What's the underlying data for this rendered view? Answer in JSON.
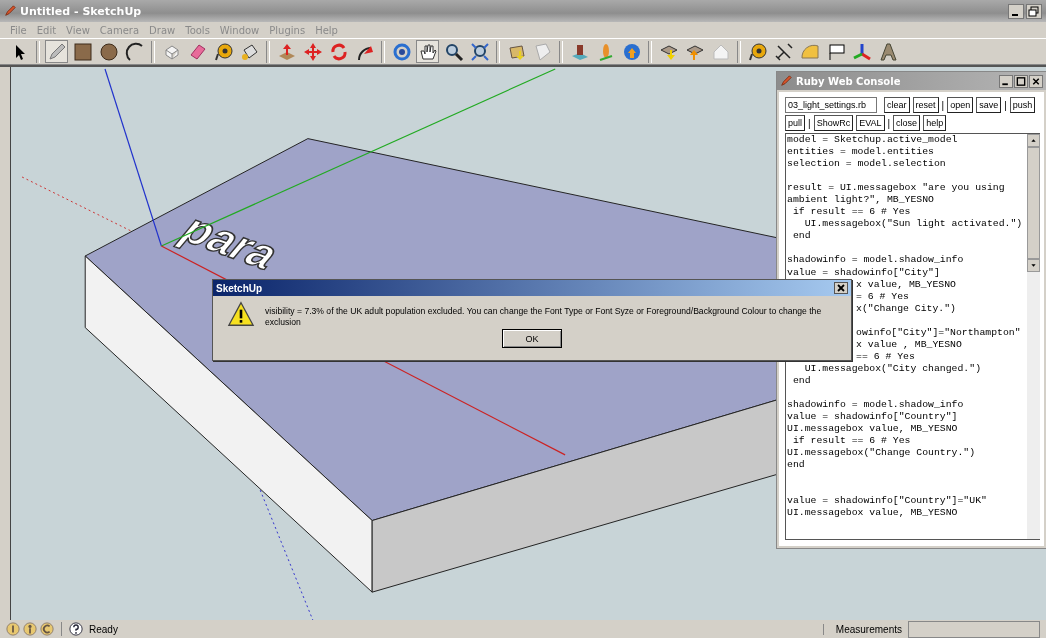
{
  "window": {
    "title": "Untitled - SketchUp"
  },
  "menu": [
    "File",
    "Edit",
    "View",
    "Camera",
    "Draw",
    "Tools",
    "Window",
    "Plugins",
    "Help"
  ],
  "toolbar": [
    {
      "kind": "select",
      "selected": false
    },
    {
      "kind": "sep"
    },
    {
      "kind": "pencil",
      "selected": true
    },
    {
      "kind": "rect",
      "selected": false
    },
    {
      "kind": "circle",
      "selected": false
    },
    {
      "kind": "arc",
      "selected": false
    },
    {
      "kind": "sep"
    },
    {
      "kind": "cube",
      "selected": false
    },
    {
      "kind": "eraser",
      "selected": false
    },
    {
      "kind": "tape",
      "selected": false
    },
    {
      "kind": "bucket",
      "selected": false
    },
    {
      "kind": "sep"
    },
    {
      "kind": "pushpull",
      "selected": false
    },
    {
      "kind": "move",
      "selected": false
    },
    {
      "kind": "rotate",
      "selected": false
    },
    {
      "kind": "offset",
      "selected": false
    },
    {
      "kind": "sep"
    },
    {
      "kind": "orbit",
      "selected": false
    },
    {
      "kind": "pan",
      "selected": true
    },
    {
      "kind": "zoom",
      "selected": false
    },
    {
      "kind": "extents",
      "selected": false
    },
    {
      "kind": "sep"
    },
    {
      "kind": "box",
      "selected": false
    },
    {
      "kind": "page",
      "selected": false
    },
    {
      "kind": "sep"
    },
    {
      "kind": "terrain",
      "selected": false
    },
    {
      "kind": "figure",
      "selected": false
    },
    {
      "kind": "globe",
      "selected": false
    },
    {
      "kind": "sep"
    },
    {
      "kind": "download",
      "selected": false
    },
    {
      "kind": "upload",
      "selected": false
    },
    {
      "kind": "house",
      "selected": false
    },
    {
      "kind": "sep"
    },
    {
      "kind": "tape",
      "selected": false
    },
    {
      "kind": "dims",
      "selected": false
    },
    {
      "kind": "protractor",
      "selected": false
    },
    {
      "kind": "label",
      "selected": false
    },
    {
      "kind": "axes",
      "selected": false
    },
    {
      "kind": "text3d",
      "selected": false
    }
  ],
  "model_text": "para",
  "console": {
    "title": "Ruby Web Console",
    "file": "03_light_settings.rb",
    "controls": [
      {
        "kind": "button",
        "label": "clear"
      },
      {
        "kind": "button",
        "label": "reset"
      },
      {
        "kind": "sep",
        "label": "|"
      },
      {
        "kind": "button",
        "label": "open"
      },
      {
        "kind": "button",
        "label": "save"
      },
      {
        "kind": "sep",
        "label": "|"
      },
      {
        "kind": "button",
        "label": "push"
      },
      {
        "kind": "button",
        "label": "pull"
      },
      {
        "kind": "sep",
        "label": "|"
      },
      {
        "kind": "button",
        "label": "ShowRc"
      },
      {
        "kind": "button",
        "label": "EVAL"
      },
      {
        "kind": "sep",
        "label": "|"
      },
      {
        "kind": "button",
        "label": "close"
      },
      {
        "kind": "button",
        "label": "help"
      }
    ],
    "blocks": [
      {
        "kind": "first",
        "lines": [
          {
            "kind": "code",
            "text": "model = Sketchup.active_model"
          },
          {
            "kind": "code",
            "text": "entities = model.entities"
          },
          {
            "kind": "code",
            "text": "selection = model.selection"
          }
        ]
      },
      {
        "kind": "spaced",
        "lines": [
          {
            "kind": "code",
            "text": "result = UI.messagebox \"are you using"
          },
          {
            "kind": "code",
            "text": "ambient light?\", MB_YESNO"
          },
          {
            "kind": "code",
            "text": " if result == 6 # Yes"
          },
          {
            "kind": "code",
            "text": "   UI.messagebox(\"Sun light activated.\")"
          },
          {
            "kind": "code",
            "text": " end"
          }
        ]
      },
      {
        "kind": "spaced",
        "lines": [
          {
            "kind": "code",
            "text": "shadowinfo = model.shadow_info"
          },
          {
            "kind": "code",
            "text": "value = shadowinfo[\"City\"]"
          },
          {
            "kind": "partial",
            "text": "x value, MB_YESNO"
          },
          {
            "kind": "partial",
            "text": "= 6 # Yes"
          },
          {
            "kind": "partial",
            "text": "x(\"Change City.\")"
          }
        ]
      },
      {
        "kind": "spaced",
        "lines": [
          {
            "kind": "partial",
            "text": "owinfo[\"City\"]=\"Northampton\""
          },
          {
            "kind": "partial",
            "text": "x value , MB_YESNO"
          },
          {
            "kind": "partial",
            "text": "== 6 # Yes"
          },
          {
            "kind": "code",
            "text": "   UI.messagebox(\"City changed.\")"
          },
          {
            "kind": "code",
            "text": " end"
          }
        ]
      },
      {
        "kind": "spaced",
        "lines": [
          {
            "kind": "code",
            "text": "shadowinfo = model.shadow_info"
          },
          {
            "kind": "code",
            "text": "value = shadowinfo[\"Country\"]"
          },
          {
            "kind": "code",
            "text": "UI.messagebox value, MB_YESNO"
          },
          {
            "kind": "code",
            "text": " if result == 6 # Yes"
          },
          {
            "kind": "code",
            "text": "UI.messagebox(\"Change Country.\")"
          },
          {
            "kind": "code",
            "text": "end"
          }
        ]
      },
      {
        "kind": "wide_spaced",
        "lines": [
          {
            "kind": "code",
            "text": "value = shadowinfo[\"Country\"]=\"UK\""
          },
          {
            "kind": "code",
            "text": "UI.messagebox value, MB_YESNO"
          }
        ]
      }
    ]
  },
  "dialog": {
    "title": "SketchUp",
    "message": "visibility = 7.3% of the UK adult population excluded. You can change the Font Type or Font Syze or Foreground/Background Colour to change the exclusion",
    "button": "OK"
  },
  "status_bar": {
    "text": "Ready",
    "measurements_label": "Measurements"
  }
}
